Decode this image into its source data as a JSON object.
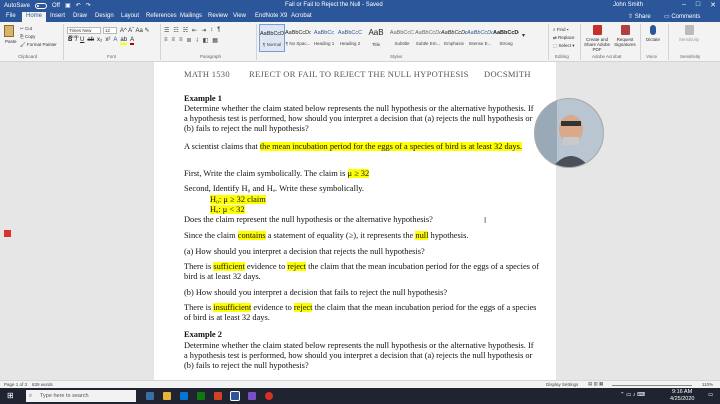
{
  "titlebar": {
    "autosave_label": "AutoSave",
    "autosave_state": "Off",
    "document_title": "Fail or Fail to Reject the Null  -  Saved",
    "user_name": "John Smith"
  },
  "tabs": [
    "File",
    "Home",
    "Insert",
    "Draw",
    "Design",
    "Layout",
    "References",
    "Mailings",
    "Review",
    "View",
    "EndNote X9",
    "Acrobat"
  ],
  "tabs_right": {
    "share": "Share",
    "comments": "Comments"
  },
  "ribbon": {
    "clipboard": {
      "paste": "Paste",
      "cut": "Cut",
      "copy": "Copy",
      "format_painter": "Format Painter",
      "label": "Clipboard"
    },
    "font": {
      "family": "Times New Rom",
      "size": "12",
      "label": "Font"
    },
    "paragraph_label": "Paragraph",
    "styles": [
      {
        "sample": "AaBbCcDc",
        "name": "¶ Normal"
      },
      {
        "sample": "AaBbCcDc",
        "name": "¶ No Spac..."
      },
      {
        "sample": "AaBbCc",
        "name": "Heading 1"
      },
      {
        "sample": "AaBbCcC",
        "name": "Heading 2"
      },
      {
        "sample": "AaB",
        "name": "Title"
      },
      {
        "sample": "AaBbCcC",
        "name": "Subtitle"
      },
      {
        "sample": "AaBbCcDd",
        "name": "Subtle Em..."
      },
      {
        "sample": "AaBbCcDd",
        "name": "Emphasis"
      },
      {
        "sample": "AaBbCcDd",
        "name": "Intense E..."
      },
      {
        "sample": "AaBbCcDd",
        "name": "Strong"
      }
    ],
    "styles_label": "Styles",
    "editing": {
      "find": "Find",
      "replace": "Replace",
      "select": "Select",
      "label": "Editing"
    },
    "acrobat": {
      "create_share": "Create and Share Adobe PDF",
      "request_signatures": "Request Signatures",
      "label": "Adobe Acrobat"
    },
    "voice": {
      "dictate": "Dictate",
      "label": "Voice"
    },
    "sensitivity": {
      "label": "Sensitivity"
    }
  },
  "document": {
    "header": {
      "course": "MATH 1530",
      "topic": "REJECT OR FAIL TO REJECT THE NULL HYPOTHESIS",
      "author": "DOCSMITH"
    },
    "example1_heading": "Example 1",
    "example1_text": "Determine whether the claim stated below represents the null hypothesis or the alternative hypothesis. If a hypothesis test is performed, how should you interpret a decision that (a) rejects the null hypothesis or (b) fails to reject the null hypothesis?",
    "claim_intro": "A scientist claims that ",
    "claim_highlight": "the mean incubation period for the eggs of a species of bird is at least 32 days.",
    "first_text": "First, Write the claim symbolically. The claim is ",
    "first_symbol": "μ ≥  32",
    "second_text": "Second, Identify H₀ and Hₐ. Write these symbolically.",
    "h0": "H₀: μ ≥  32 claim",
    "ha": "Hₐ: μ < 32",
    "question_null": "Does the claim represent the null hypothesis or the alternative hypothesis?",
    "since_a": "Since the claim ",
    "since_hl1": "contains",
    "since_b": " a statement of equality (≥), it represents the ",
    "since_hl2": "null",
    "since_c": " hypothesis.",
    "qa": "(a) How should you interpret a decision that rejects the null hypothesis?",
    "ans_a1": "There is ",
    "ans_a_hl1": "sufficient",
    "ans_a2": " evidence to ",
    "ans_a_hl2": "reject",
    "ans_a3": " the claim that the mean incubation period for the eggs of a species of bird is at least 32 days.",
    "qb": "(b) How should you interpret a decision that fails to reject the null hypothesis?",
    "ans_b1": "There is ",
    "ans_b_hl1": "insufficient",
    "ans_b2": " evidence to ",
    "ans_b_hl2": "reject",
    "ans_b3": "  the claim that the mean incubation period for the eggs of a species of bird is at least 32 days.",
    "example2_heading": "Example 2",
    "example2_text": "Determine whether the claim stated below represents the null hypothesis or the alternative hypothesis. If a hypothesis test is performed, how should you interpret a decision that (a) rejects the null hypothesis or (b) fails to reject the null hypothesis?"
  },
  "statusbar": {
    "page": "Page 1 of 3",
    "words": "839 words",
    "display_settings": "Display Settings",
    "zoom": "110%"
  },
  "taskbar": {
    "search_placeholder": "Type here to search",
    "time": "9:16 AM",
    "date": "4/25/2020"
  },
  "colors": {
    "word_blue": "#2b579a",
    "highlight": "#ffff00",
    "taskbar": "#1f2430"
  }
}
